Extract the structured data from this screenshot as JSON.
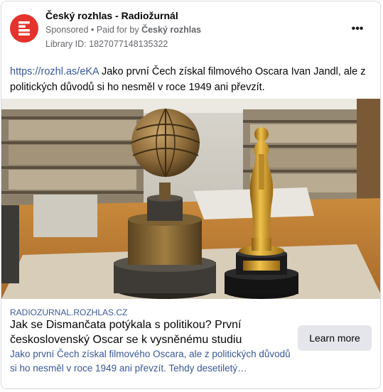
{
  "advertiser": {
    "name": "Český rozhlas - Radiožurnál",
    "sponsored_label": "Sponsored",
    "paid_for_prefix": "Paid for by",
    "paid_for_by": "Český rozhlas",
    "library_id": "Library ID: 1827077148135322"
  },
  "post": {
    "link_text": "https://rozhl.as/eKA",
    "text": "Jako první Čech získal filmového Oscara Ivan Jandl, ale z politických důvodů si ho nesměl v roce 1949 ani převzít."
  },
  "link_preview": {
    "domain": "RADIOZURNAL.ROZHLAS.CZ",
    "headline": "Jak se Dismančata potýkala s politikou? První československý Oscar se k vysněnému studiu herectví…",
    "description": "Jako první Čech získal filmového Oscara, ale z politických důvodů si ho nesměl v roce 1949 ani převzít. Tehdy desetiletý…",
    "cta_label": "Learn more"
  },
  "icons": {
    "logo": "cesky-rozhlas-logo",
    "more": "more-options-icon"
  },
  "colors": {
    "brand": "#e3332c",
    "link": "#385898",
    "muted": "#65676b",
    "cta_bg": "#e4e6eb"
  }
}
